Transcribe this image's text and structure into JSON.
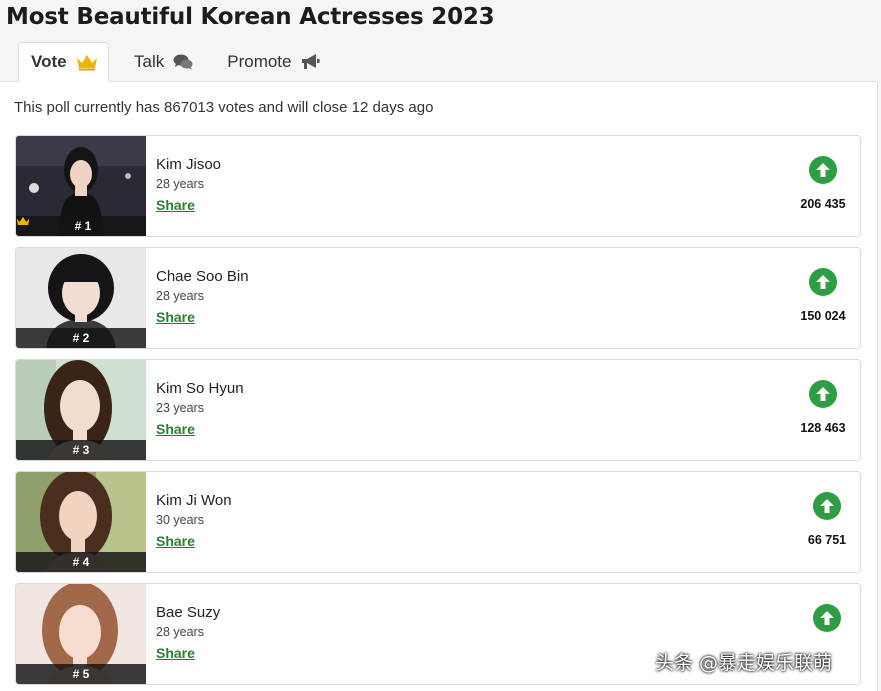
{
  "page": {
    "title": "Most Beautiful Korean Actresses 2023"
  },
  "tabs": [
    {
      "label": "Vote",
      "icon": "crown-icon"
    },
    {
      "label": "Talk",
      "icon": "chat-bubbles-icon"
    },
    {
      "label": "Promote",
      "icon": "megaphone-icon"
    }
  ],
  "poll": {
    "info": "This poll currently has 867013 votes and will close 12 days ago"
  },
  "share_label": "Share",
  "colors": {
    "vote_green": "#2e9e44",
    "share_green": "#2e7d32",
    "crown_gold": "#f0b400"
  },
  "candidates": [
    {
      "name": "Kim Jisoo",
      "age": "28 years",
      "rank": "# 1",
      "votes": "206 435",
      "crown": true
    },
    {
      "name": "Chae Soo Bin",
      "age": "28 years",
      "rank": "# 2",
      "votes": "150 024"
    },
    {
      "name": "Kim So Hyun",
      "age": "23 years",
      "rank": "# 3",
      "votes": "128 463"
    },
    {
      "name": "Kim Ji Won",
      "age": "30 years",
      "rank": "# 4",
      "votes": "66 751"
    },
    {
      "name": "Bae Suzy",
      "age": "28 years",
      "rank": "# 5",
      "votes": ""
    }
  ],
  "watermark": "头条 @暴走娱乐联萌"
}
